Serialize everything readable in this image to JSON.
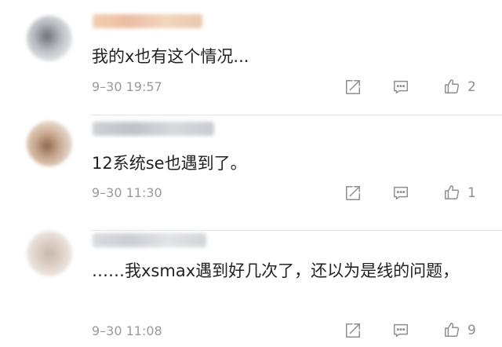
{
  "comments": [
    {
      "text": "我的x也有这个情况...",
      "time": "9–30 19:57",
      "likes": "2",
      "avatar_icon": "user-avatar-blurred",
      "username_icon": "blurred-username"
    },
    {
      "text": "12系统se也遇到了。",
      "time": "9–30 11:30",
      "likes": "1",
      "avatar_icon": "user-avatar-blurred",
      "username_icon": "blurred-username"
    },
    {
      "text": "……我xsmax遇到好几次了，还以为是线的问题，",
      "time": "9–30 11:08",
      "likes": "9",
      "avatar_icon": "user-avatar-blurred",
      "username_icon": "blurred-username"
    }
  ],
  "icons": {
    "share": "share-icon",
    "reply": "comment-icon",
    "like": "thumbs-up-icon"
  },
  "colors": {
    "text": "#222222",
    "meta": "#9a9a9a",
    "icon": "#8e8e8e",
    "divider": "#e6e6e6"
  }
}
